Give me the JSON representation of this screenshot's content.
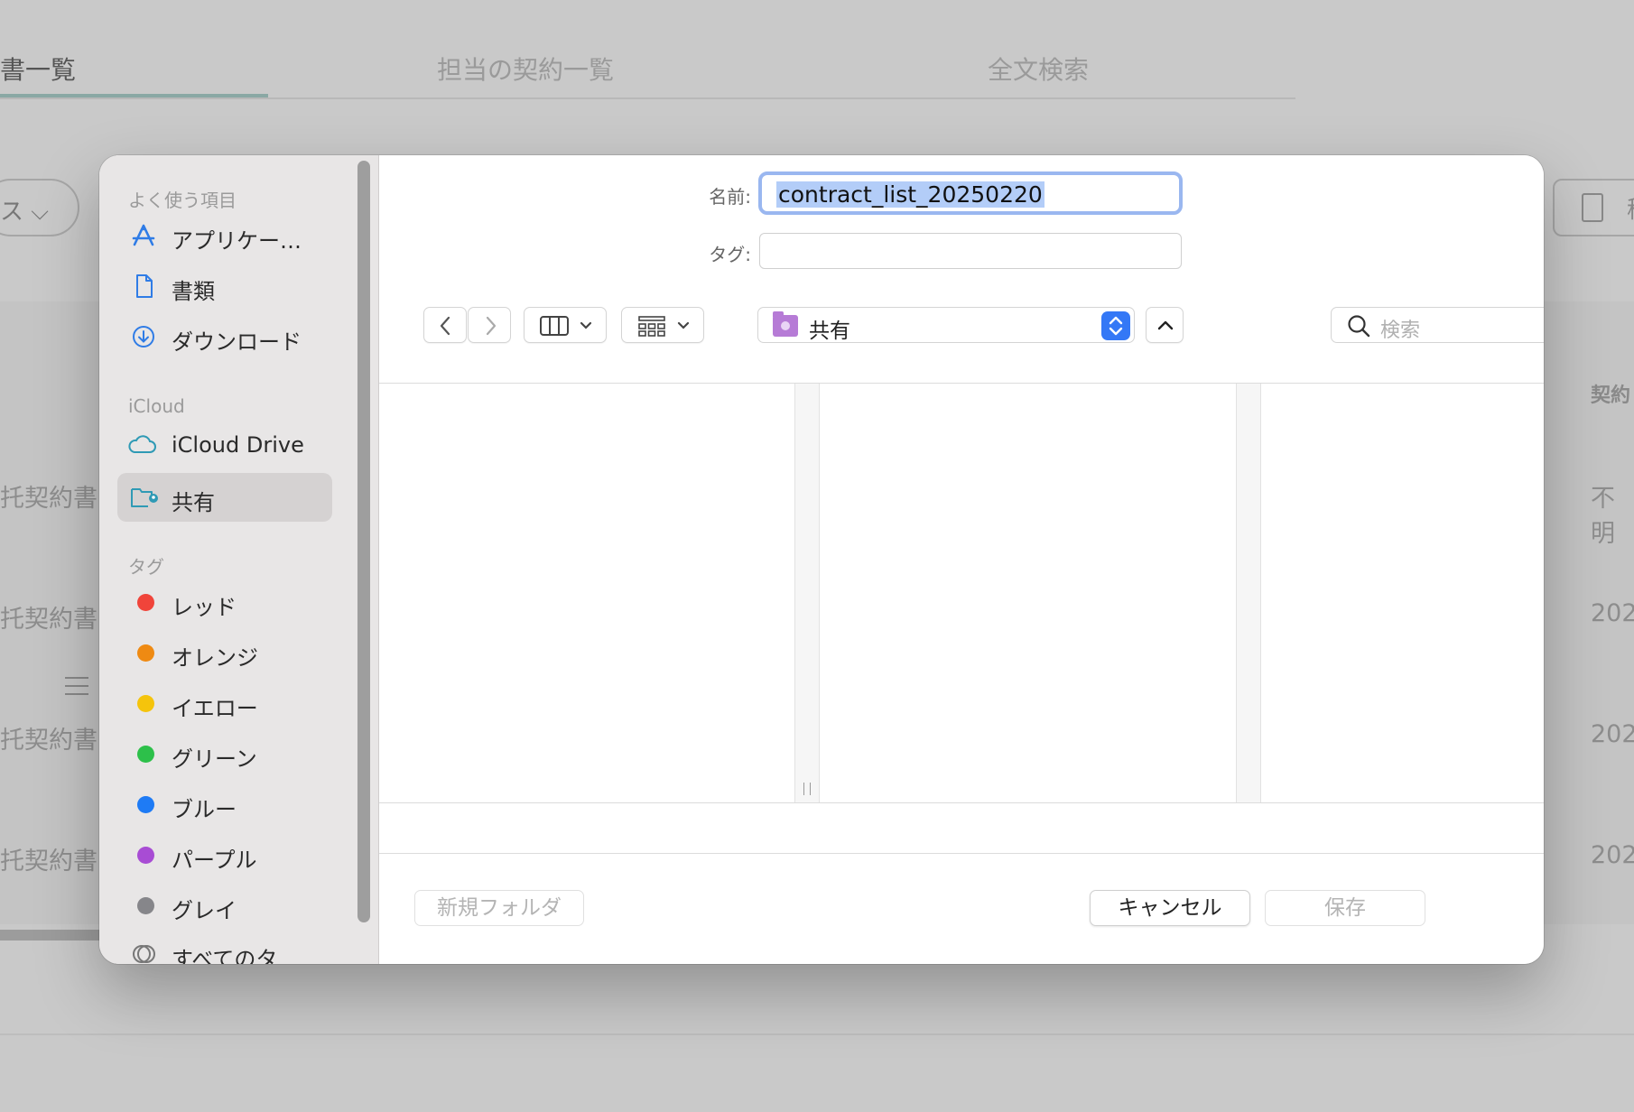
{
  "background": {
    "tabs": [
      "書一覧",
      "担当の契約一覧",
      "全文検索"
    ],
    "filter_pill": "ス",
    "rows": [
      "托契約書",
      "托契約書",
      "托契約書",
      "托契約書"
    ],
    "right_header": "契約",
    "right_values": [
      "不明",
      "202",
      "202",
      "202"
    ],
    "right_button": "移"
  },
  "sidebar": {
    "favorites_header": "よく使う項目",
    "favorites": [
      {
        "label": "アプリケー…",
        "icon": "applications-icon"
      },
      {
        "label": "書類",
        "icon": "document-icon"
      },
      {
        "label": "ダウンロード",
        "icon": "download-icon"
      }
    ],
    "icloud_header": "iCloud",
    "icloud": [
      {
        "label": "iCloud Drive",
        "icon": "cloud-icon"
      },
      {
        "label": "共有",
        "icon": "shared-folder-icon",
        "selected": true
      }
    ],
    "tags_header": "タグ",
    "tags": [
      {
        "label": "レッド",
        "color": "#f0443a"
      },
      {
        "label": "オレンジ",
        "color": "#ef8a12"
      },
      {
        "label": "イエロー",
        "color": "#f5c40c"
      },
      {
        "label": "グリーン",
        "color": "#2dc04a"
      },
      {
        "label": "ブルー",
        "color": "#1e7bf5"
      },
      {
        "label": "パープル",
        "color": "#a84cd4"
      },
      {
        "label": "グレイ",
        "color": "#86868a"
      }
    ],
    "all_tags": "すべてのタ…"
  },
  "form": {
    "name_label": "名前:",
    "name_value": "contract_list_20250220",
    "tag_label": "タグ:",
    "tag_value": ""
  },
  "toolbar": {
    "location": "共有",
    "search_placeholder": "検索"
  },
  "footer": {
    "new_folder": "新規フォルダ",
    "cancel": "キャンセル",
    "save": "保存"
  }
}
